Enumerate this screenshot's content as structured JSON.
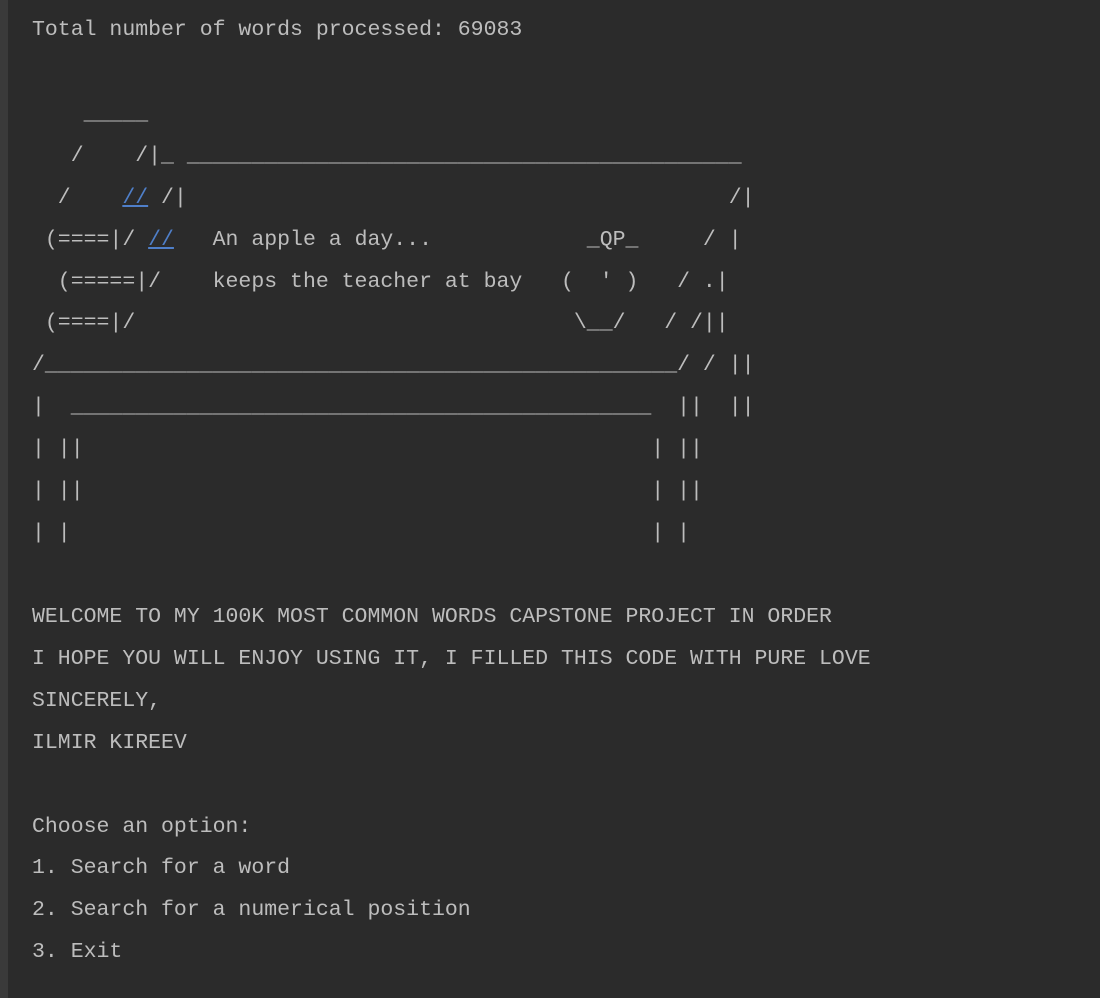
{
  "header_line": "Total number of words processed: 69083",
  "ascii_art": {
    "l1": "    _____",
    "l2": "   /    /|_ ___________________________________________",
    "l3a": "  /    ",
    "l3link": "//",
    "l3b": " /|                                          /|",
    "l4a": " (====|/ ",
    "l4link": "//",
    "l4b": "   An apple a day...            _QP_     / |",
    "l5": "  (=====|/    keeps the teacher at bay   (  ' )   / .|",
    "l6": " (====|/                                  \\__/   / /||",
    "l7": "/_________________________________________________/ / ||",
    "l8": "|  _____________________________________________  ||  ||",
    "l9": "| ||                                            | ||",
    "l10": "| ||                                            | ||",
    "l11": "| |                                             | |"
  },
  "welcome": {
    "line1": "WELCOME TO MY 100K MOST COMMON WORDS CAPSTONE PROJECT IN ORDER",
    "line2": "I HOPE YOU WILL ENJOY USING IT, I FILLED THIS CODE WITH PURE LOVE",
    "line3": "SINCERELY,",
    "line4": "ILMIR KIREEV"
  },
  "menu": {
    "prompt": "Choose an option:",
    "options": [
      "1. Search for a word",
      "2. Search for a numerical position",
      "3. Exit"
    ]
  }
}
